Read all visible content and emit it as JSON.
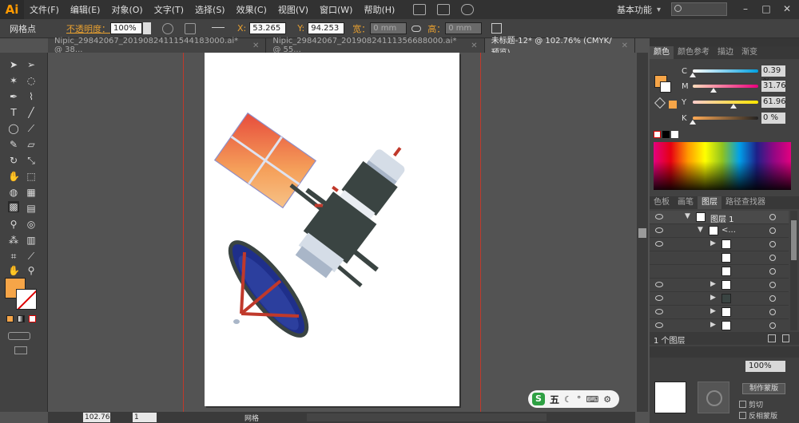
{
  "app": {
    "logo": "Ai"
  },
  "menu": [
    "文件(F)",
    "编辑(E)",
    "对象(O)",
    "文字(T)",
    "选择(S)",
    "效果(C)",
    "视图(V)",
    "窗口(W)",
    "帮助(H)"
  ],
  "workspace": {
    "label": "基本功能",
    "caret": "▾"
  },
  "window_controls": {
    "min": "–",
    "max": "□",
    "close": "✕"
  },
  "control_bar": {
    "mode": "网格点",
    "opacity_label": "不透明度：",
    "opacity_value": "100%",
    "x_label": "X:",
    "x_value": "53.265",
    "y_label": "Y:",
    "y_value": "94.253",
    "w_label": "宽：",
    "w_value": "0 mm",
    "h_label": "高：",
    "h_value": "0 mm"
  },
  "tabs": [
    {
      "label": "Nipic_29842067_20190824111544183000.ai* @ 38...",
      "active": false
    },
    {
      "label": "Nipic_29842067_20190824111356688000.ai* @ 55...",
      "active": false
    },
    {
      "label": "未标题-12* @ 102.76% (CMYK/预览)",
      "active": true
    }
  ],
  "tab_close": "✕",
  "color_panel": {
    "tabs": [
      "颜色",
      "颜色参考",
      "描边",
      "渐变"
    ],
    "channels": [
      {
        "name": "C",
        "value": "0.39 %",
        "level": 0.004,
        "gradient": "linear-gradient(90deg,#fff,#00a0e0)"
      },
      {
        "name": "M",
        "value": "31.76",
        "level": 0.32,
        "gradient": "linear-gradient(90deg,#fdb,#e8007d)"
      },
      {
        "name": "Y",
        "value": "61.96",
        "level": 0.62,
        "gradient": "linear-gradient(90deg,#fcc,#ffe600)"
      },
      {
        "name": "K",
        "value": "0 %",
        "level": 0.0,
        "gradient": "linear-gradient(90deg,#fa5,#222)"
      }
    ],
    "fill_color": "#f6a548"
  },
  "layers_panel": {
    "tabs": [
      "色板",
      "画笔",
      "图层",
      "路径查找器"
    ],
    "top_layer": "图层 1",
    "group_label": "<...",
    "footer": "1 个图层"
  },
  "lower_panel": {
    "opacity": "100%",
    "make_mask": "制作蒙版",
    "clip": "剪切",
    "invert": "反相蒙版"
  },
  "status": {
    "zoom": "102.76",
    "page": "1",
    "label": "网格"
  },
  "ime": {
    "logo": "S",
    "text": "五"
  }
}
